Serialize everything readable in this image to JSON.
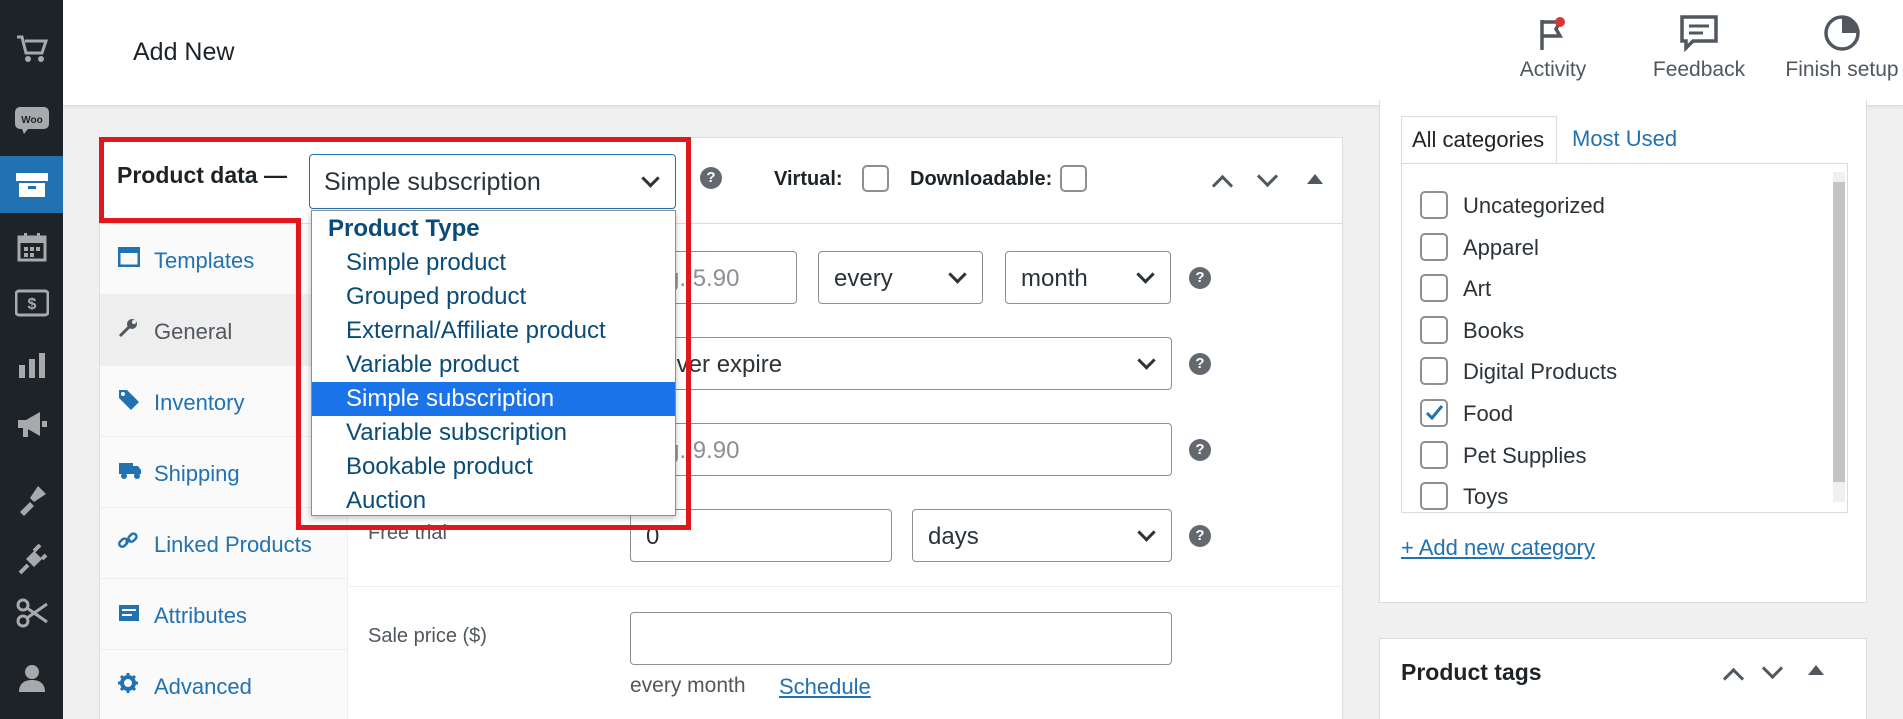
{
  "header": {
    "title": "Add New",
    "actions": [
      {
        "label": "Activity",
        "icon": "activity-flag-icon"
      },
      {
        "label": "Feedback",
        "icon": "feedback-icon"
      },
      {
        "label": "Finish setup",
        "icon": "finish-setup-icon"
      }
    ]
  },
  "sidebar": {
    "icons": [
      "cart-icon",
      "woo-icon",
      "products-icon",
      "bookings-icon",
      "payments-icon",
      "analytics-icon",
      "marketing-icon",
      "appearance-icon",
      "plugins-icon",
      "tools-icon",
      "users-icon"
    ]
  },
  "product_data": {
    "title": "Product data —",
    "type_selected": "Simple subscription",
    "virtual_label": "Virtual:",
    "downloadable_label": "Downloadable:",
    "dropdown": {
      "group_label": "Product Type",
      "options": [
        "Simple product",
        "Grouped product",
        "External/Affiliate product",
        "Variable product",
        "Simple subscription",
        "Variable subscription",
        "Bookable product",
        "Auction"
      ],
      "selected_index": 4
    },
    "tabs": [
      {
        "label": "Templates",
        "icon": "templates-icon"
      },
      {
        "label": "General",
        "icon": "wrench-icon"
      },
      {
        "label": "Inventory",
        "icon": "inventory-tag-icon"
      },
      {
        "label": "Shipping",
        "icon": "truck-icon"
      },
      {
        "label": "Linked Products",
        "icon": "link-icon"
      },
      {
        "label": "Attributes",
        "icon": "attributes-icon"
      },
      {
        "label": "Advanced",
        "icon": "gear-icon"
      }
    ],
    "fields": {
      "price_placeholder": "e.g. 5.90",
      "period_interval": "every",
      "period": "month",
      "expire": "Never expire",
      "signup_fee_placeholder": "e.g. 9.90",
      "free_trial_label": "Free trial",
      "free_trial_value": "0",
      "free_trial_unit": "days",
      "sale_price_label": "Sale price ($)",
      "sale_price_value": "",
      "sale_desc": "every month",
      "schedule_link": "Schedule"
    }
  },
  "categories": {
    "tab_all": "All categories",
    "tab_most_used": "Most Used",
    "items": [
      {
        "label": "Uncategorized",
        "checked": false
      },
      {
        "label": "Apparel",
        "checked": false
      },
      {
        "label": "Art",
        "checked": false
      },
      {
        "label": "Books",
        "checked": false
      },
      {
        "label": "Digital Products",
        "checked": false
      },
      {
        "label": "Food",
        "checked": true
      },
      {
        "label": "Pet Supplies",
        "checked": false
      },
      {
        "label": "Toys",
        "checked": false
      }
    ],
    "add_new": "+ Add new category"
  },
  "tags": {
    "title": "Product tags"
  },
  "colors": {
    "accent": "#2271b1",
    "highlight_box": "#e2161d",
    "selected_option": "#1a73e8",
    "admin_bar": "#1d2327"
  }
}
